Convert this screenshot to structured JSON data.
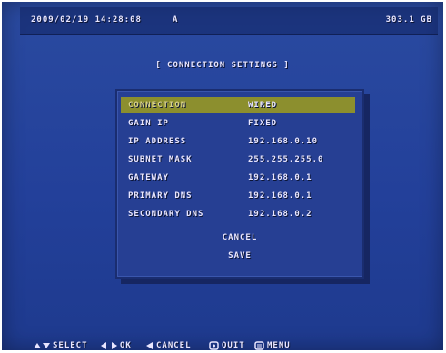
{
  "status_bar": {
    "datetime": "2009/02/19 14:28:08",
    "mode": "A",
    "storage": "303.1 GB"
  },
  "title": "[ CONNECTION SETTINGS ]",
  "settings": [
    {
      "label": "CONNECTION",
      "value": "WIRED"
    },
    {
      "label": "GAIN IP",
      "value": "FIXED"
    },
    {
      "label": "IP ADDRESS",
      "value": "192.168.0.10"
    },
    {
      "label": "SUBNET MASK",
      "value": "255.255.255.0"
    },
    {
      "label": "GATEWAY",
      "value": "192.168.0.1"
    },
    {
      "label": "PRIMARY DNS",
      "value": "192.168.0.1"
    },
    {
      "label": "SECONDARY DNS",
      "value": "192.168.0.2"
    }
  ],
  "actions": {
    "cancel": "CANCEL",
    "save": "SAVE"
  },
  "hints": {
    "select": "SELECT",
    "ok": "OK",
    "cancel": "CANCEL",
    "quit": "QUIT",
    "menu": "MENU"
  }
}
